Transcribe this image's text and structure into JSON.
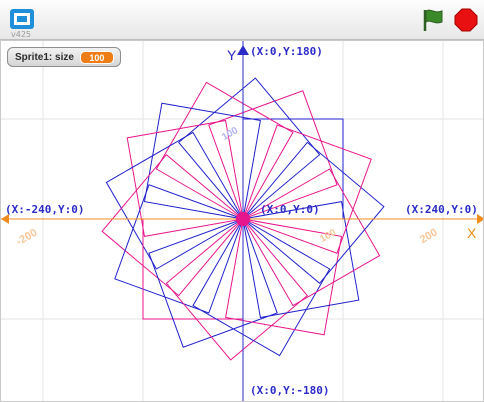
{
  "titlebar": {
    "version": "v425",
    "fullscreen_icon": "fullscreen-icon",
    "flag_icon": "green-flag-icon",
    "stop_icon": "stop-sign-icon"
  },
  "monitor": {
    "label": "Sprite1: size",
    "value": "100"
  },
  "axes": {
    "x_letter": "X",
    "y_letter": "Y",
    "top_label": "(X:0,Y:180)",
    "bottom_label": "(X:0,Y:-180)",
    "left_label": "(X:-240,Y:0)",
    "right_label": "(X:240,Y:0)",
    "center_label": "(X:0,Y:0)",
    "tick_left": "-200",
    "tick_right": "200",
    "tick_up": "100",
    "tick_right_small": "100"
  },
  "colors": {
    "x_axis": "#f08c1e",
    "y_axis": "#2b2bc8",
    "pattern_blue": "#2222cc",
    "pattern_magenta": "#e8168c",
    "center": "#e8168c",
    "stop": "#e81010",
    "flag": "#3a8a2a"
  },
  "pattern": {
    "squares": 18,
    "rotation_step_deg": 20,
    "side_steps": 100
  }
}
